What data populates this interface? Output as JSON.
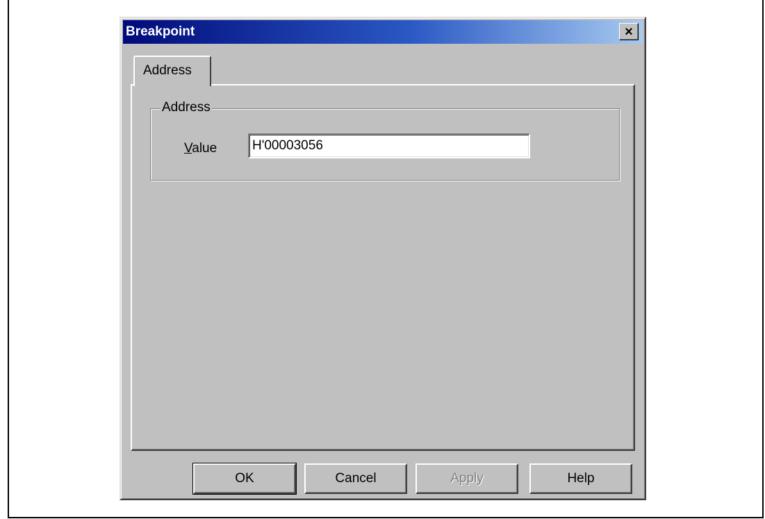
{
  "dialog": {
    "title": "Breakpoint",
    "close_glyph": "×"
  },
  "tabs": [
    {
      "label": "Address",
      "selected": true
    }
  ],
  "address_group": {
    "legend": "Address",
    "value_label": "Value",
    "value_mnemonic": "V",
    "value_label_rest": "alue",
    "value_input": "H'00003056"
  },
  "buttons": {
    "ok": "OK",
    "cancel": "Cancel",
    "apply": "Apply",
    "help": "Help"
  },
  "icons": {
    "close": "close-icon"
  },
  "colors": {
    "face": "#c0c0c0",
    "titlebar_start": "#000a7a",
    "titlebar_end": "#a6caf0",
    "title_text": "#ffffff"
  }
}
